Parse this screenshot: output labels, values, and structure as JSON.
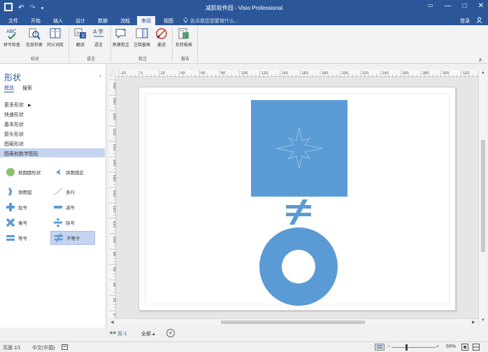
{
  "window": {
    "title": "减肌软件园 - Visio Professional",
    "minimize": "—",
    "maximize": "□",
    "close": "✕"
  },
  "quick_access": {
    "undo": "↶",
    "redo": "↷"
  },
  "tabs": [
    {
      "label": "文件"
    },
    {
      "label": "开始"
    },
    {
      "label": "插入"
    },
    {
      "label": "设计"
    },
    {
      "label": "数据"
    },
    {
      "label": "流程"
    },
    {
      "label": "审阅"
    },
    {
      "label": "视图"
    }
  ],
  "active_tab": "审阅",
  "tellme": {
    "text": "告诉我您想要做什么..."
  },
  "account": {
    "signin": "登录",
    "share": "共享"
  },
  "ribbon": {
    "buttons": [
      {
        "label": "拼写检查",
        "icon": "spell-check-icon"
      },
      {
        "label": "信息检索",
        "icon": "research-icon"
      },
      {
        "label": "同义词库",
        "icon": "thesaurus-icon"
      },
      {
        "label": "翻译",
        "icon": "translate-icon"
      },
      {
        "label": "语言",
        "icon": "language-icon"
      },
      {
        "label": "新建批注",
        "icon": "new-comment-icon"
      },
      {
        "label": "注释窗格",
        "icon": "comment-pane-icon"
      },
      {
        "label": "墨迹",
        "icon": "ink-icon"
      },
      {
        "label": "形状报表",
        "icon": "shape-reports-icon"
      }
    ],
    "groups": [
      {
        "label": "校对"
      },
      {
        "label": "语言"
      },
      {
        "label": "批注"
      },
      {
        "label": "报告"
      }
    ]
  },
  "shapes_pane": {
    "title": "形状",
    "subtabs": [
      "模具",
      "搜索"
    ],
    "stencils": [
      {
        "label": "更多形状"
      },
      {
        "label": "快速形状"
      },
      {
        "label": "基本形状"
      },
      {
        "label": "箭头形状"
      },
      {
        "label": "图案形状"
      },
      {
        "label": "图表和数学图形"
      }
    ],
    "masters": [
      {
        "label": "按圆圆形状"
      },
      {
        "label": "饼图扇区"
      },
      {
        "label": "饼图弧"
      },
      {
        "label": "多行"
      },
      {
        "label": "加号"
      },
      {
        "label": "减号"
      },
      {
        "label": "乘号"
      },
      {
        "label": "除号"
      },
      {
        "label": "等号"
      },
      {
        "label": "不等于"
      }
    ]
  },
  "ruler": {
    "top_labels": [
      "-20",
      "0",
      "20",
      "40",
      "60",
      "80",
      "100",
      "120",
      "140",
      "160",
      "180",
      "200",
      "220",
      "240",
      "260",
      "280",
      "300",
      "320"
    ],
    "left_labels": [
      "300",
      "280",
      "260",
      "240",
      "220",
      "200",
      "180",
      "160",
      "140",
      "120",
      "100",
      "80",
      "60",
      "40",
      "20",
      "0"
    ]
  },
  "page_tabs": {
    "nav": "◀ ▶",
    "current": "页-1",
    "all": "全部 ▴",
    "add": "+"
  },
  "status": {
    "page": "页面 1/1",
    "language": "中文(中国)",
    "zoom": "69%"
  },
  "colors": {
    "title_blue": "#2b579a",
    "shape_blue": "#5b9bd5",
    "selected_stencil": "#c5d4ef"
  }
}
